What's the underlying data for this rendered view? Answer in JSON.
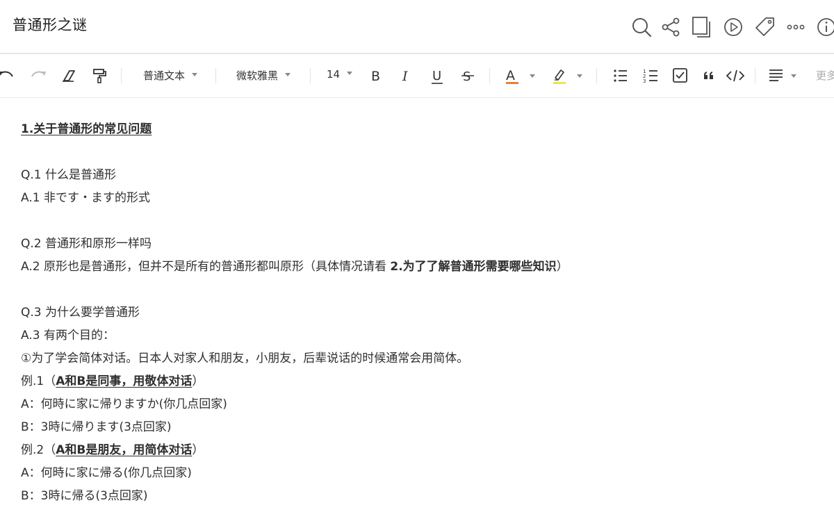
{
  "document": {
    "title": "普通形之谜"
  },
  "toolbar": {
    "paragraph_style": "普通文本",
    "font_family": "微软雅黑",
    "font_size": "14",
    "more_label": "更多",
    "text_color": "#e87e3a",
    "highlight_color": "#f6e04a"
  },
  "content": {
    "heading": "1.关于普通形的常见问题",
    "q1": "Q.1 什么是普通形",
    "a1": "A.1  非です・ます的形式",
    "q2": "Q.2  普通形和原形一样吗",
    "a2_pre": "A.2  原形也是普通形，但并不是所有的普通形都叫原形（具体情况请看 ",
    "a2_bold": "2.为了了解普通形需要哪些知识",
    "a2_post": "）",
    "q3": "Q.3 为什么要学普通形",
    "a3": "A.3 有两个目的：",
    "p1": "①为了学会简体对话。日本人对家人和朋友，小朋友，后辈说话的时候通常会用简体。",
    "ex1_pre": "例.1（",
    "ex1_bold": "A和B是同事，用敬体对话",
    "ex1_post": "）",
    "ex1_a": "A：何時に家に帰りますか(你几点回家)",
    "ex1_b": "B：3時に帰ります(3点回家)",
    "ex2_pre": "例.2（",
    "ex2_bold": "A和B是朋友，用简体对话",
    "ex2_post": "）",
    "ex2_a": "A：何時に家に帰る(你几点回家)",
    "ex2_b": "B：3時に帰る(3点回家)"
  }
}
